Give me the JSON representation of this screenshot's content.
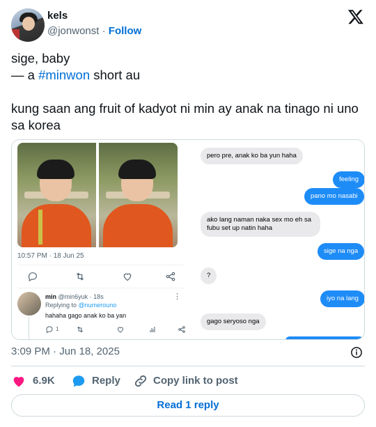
{
  "author": {
    "name": "kels",
    "handle": "@jonwonst",
    "separator": "·",
    "follow_label": "Follow"
  },
  "tweet": {
    "line1": "sige, baby",
    "line2_prefix": "— a ",
    "hashtag": "#minwon",
    "line2_suffix": " short au",
    "line3": "kung saan ang fruit of kadyot ni min ay anak na tinago ni uno sa korea"
  },
  "embedded_tweet": {
    "time": "10:57 PM · 18 Jun 25",
    "reply": {
      "name": "min",
      "handle_time": "@min6yuk · 18s",
      "replying_to_prefix": "Replying to ",
      "replying_to_handle": "@numerouno",
      "text": "hahaha gago anak ko ba yan",
      "reply_count": "1",
      "menu": "⋮"
    }
  },
  "chat": {
    "messages": [
      {
        "side": "in",
        "text": "pero pre, anak ko ba yun haha"
      },
      {
        "side": "out",
        "text": "feeling"
      },
      {
        "side": "out",
        "text": "pano mo nasabi"
      },
      {
        "side": "in",
        "text": "ako lang naman naka sex mo eh sa fubu set up natin haha"
      },
      {
        "side": "out",
        "text": "sige na nga"
      },
      {
        "side": "in",
        "text": "?"
      },
      {
        "side": "out",
        "text": "iyo na lang"
      },
      {
        "side": "in",
        "text": "gago seryoso nga"
      }
    ]
  },
  "footer": {
    "timestamp": "3:09 PM · Jun 18, 2025",
    "like_count": "6.9K",
    "reply_label": "Reply",
    "copy_label": "Copy link to post",
    "read_replies_label": "Read 1 reply"
  },
  "colors": {
    "link": "#006fd6",
    "heart": "#f91880",
    "bubble_out": "#1e8cf7",
    "bubble_in": "#e9e9eb"
  },
  "icons": [
    "x-logo-icon",
    "info-icon",
    "heart-icon",
    "reply-bubble-icon",
    "link-icon",
    "retweet-icon",
    "share-icon",
    "analytics-icon"
  ]
}
